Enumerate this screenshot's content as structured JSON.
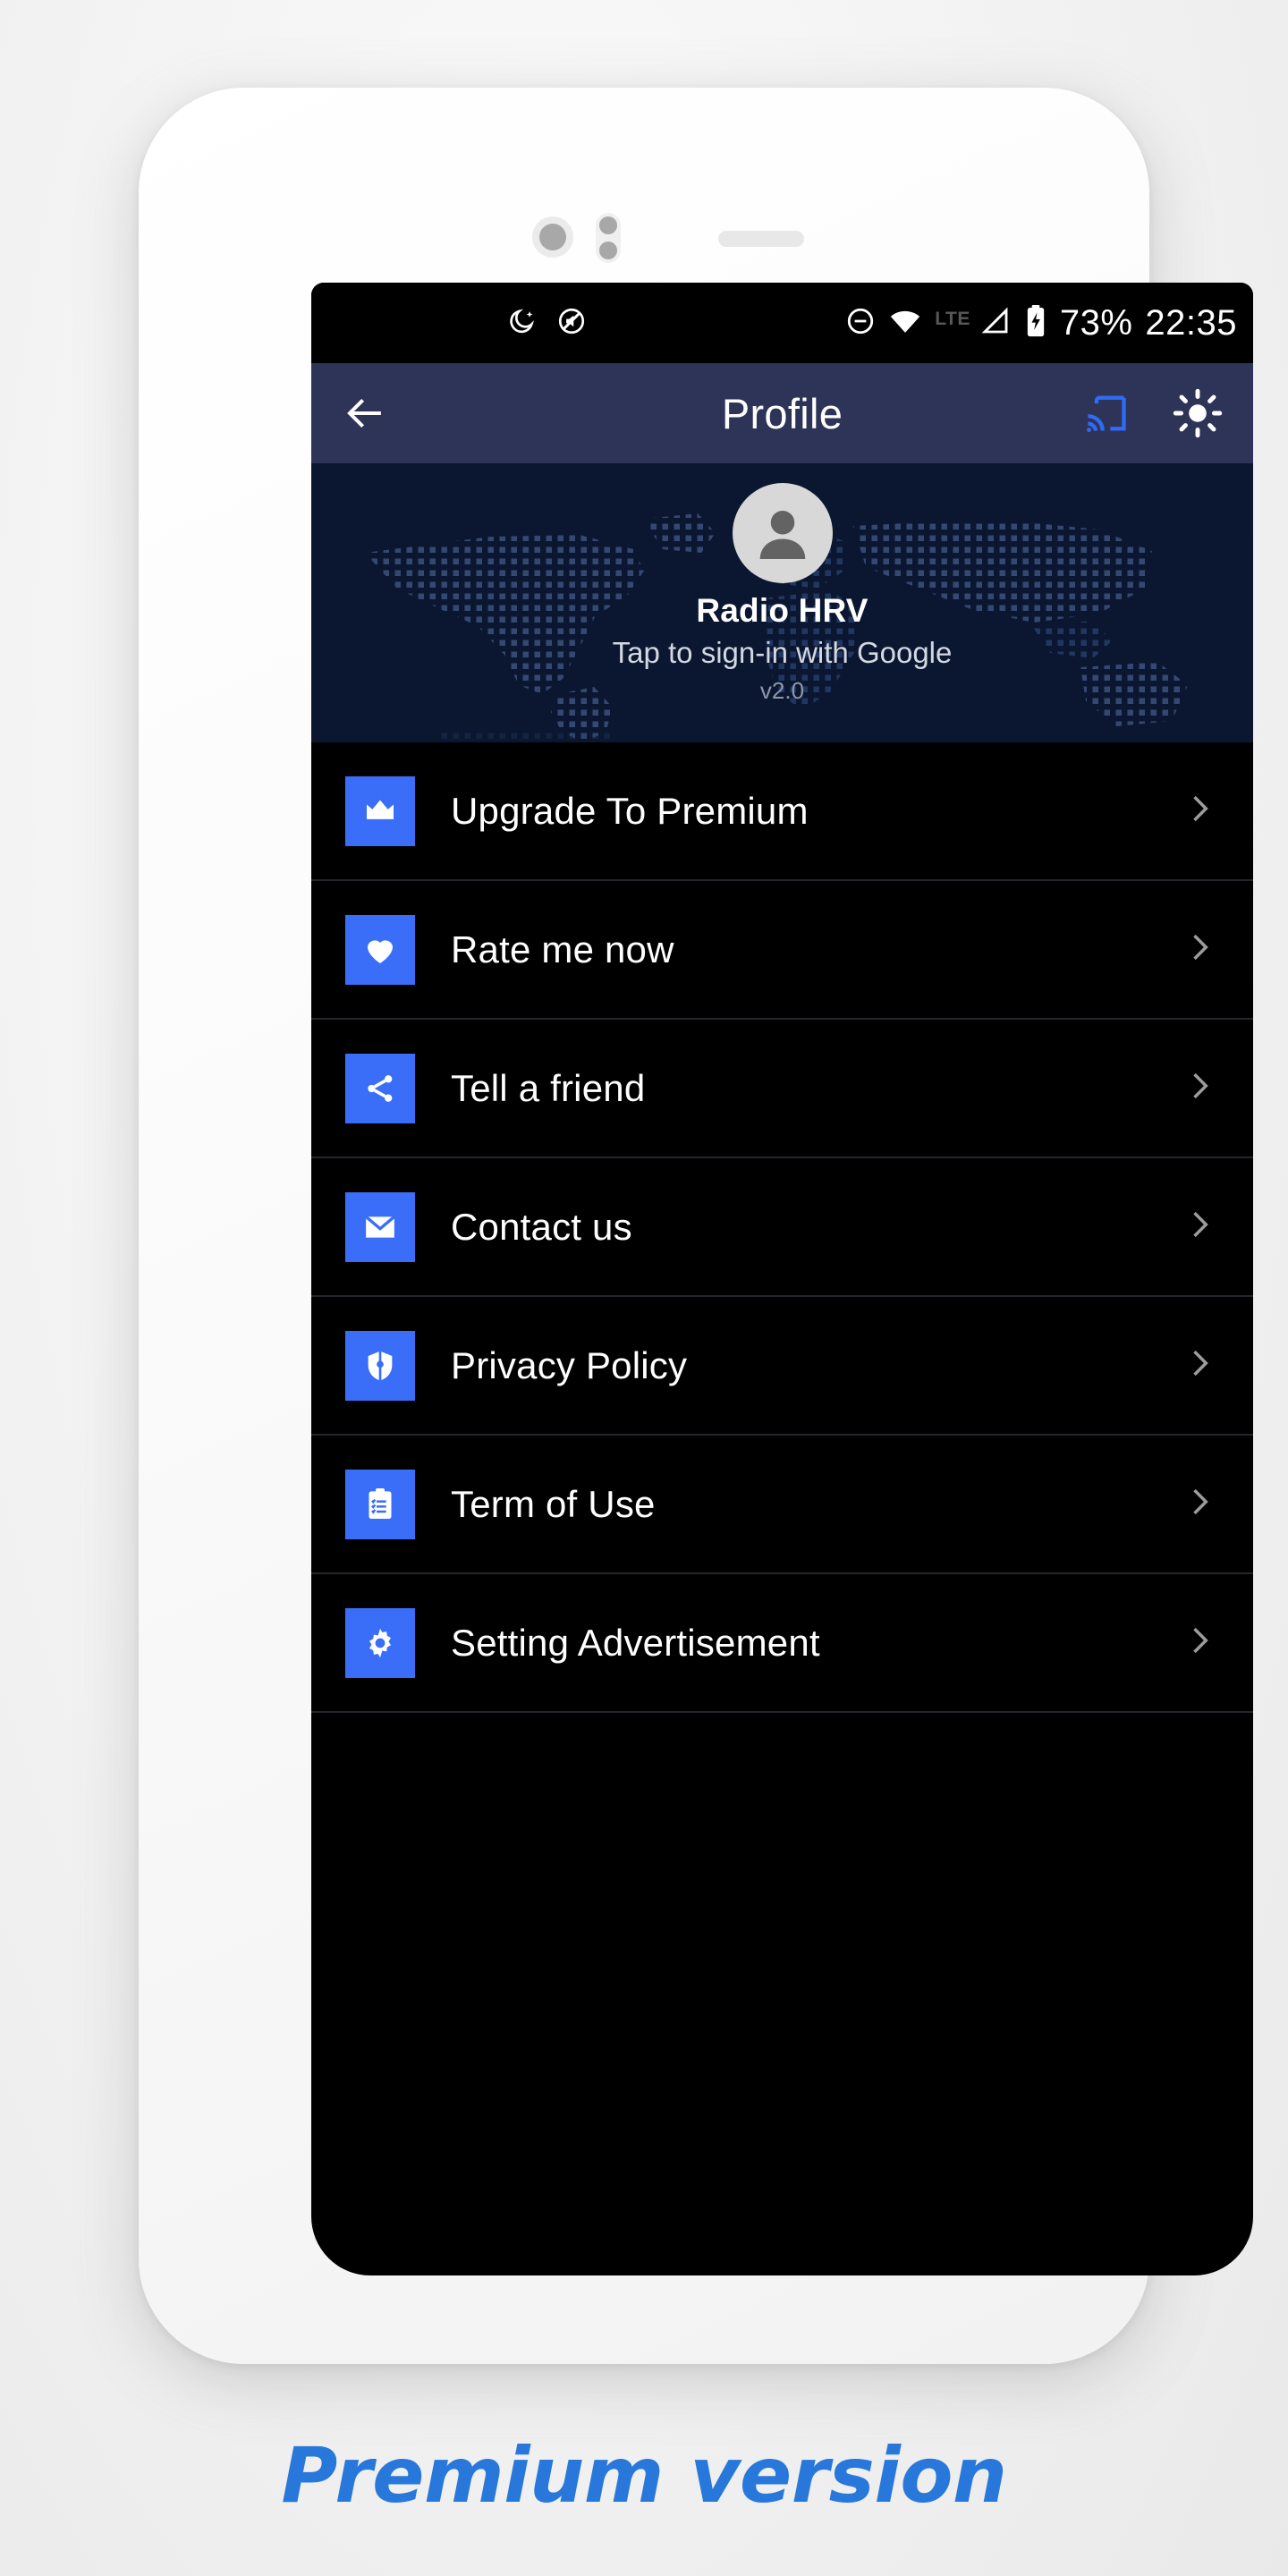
{
  "theme": {
    "accent_blue": "#3b6ef8",
    "appbar_bg": "#2e3457",
    "header_bg": "#0b1730",
    "list_bg": "#000000",
    "caption_blue": "#2878dc",
    "page_bg": "#f4f4f4"
  },
  "status_bar": {
    "left_icons": [
      "do-not-disturb-moon-icon",
      "no-sound-slash-icon"
    ],
    "right_icons": [
      "mute-minus-circle-icon",
      "wifi-icon",
      "cell-signal-icon",
      "battery-charging-icon"
    ],
    "network_label": "LTE",
    "battery_percent": "73%",
    "clock": "22:35"
  },
  "app_bar": {
    "back_icon": "arrow-left-icon",
    "title": "Profile",
    "cast_icon": "cast-icon",
    "brightness_icon": "brightness-sun-icon"
  },
  "profile": {
    "avatar_icon": "person-avatar-icon",
    "background_icon": "dotted-world-map",
    "name": "Radio HRV",
    "signin_prompt": "Tap to sign-in with Google",
    "version": "v2.0"
  },
  "menu": {
    "items": [
      {
        "label": "Upgrade To Premium",
        "icon": "crown-icon",
        "chevron": "chevron-right-icon"
      },
      {
        "label": "Rate me now",
        "icon": "heart-icon",
        "chevron": "chevron-right-icon"
      },
      {
        "label": "Tell a friend",
        "icon": "share-icon",
        "chevron": "chevron-right-icon"
      },
      {
        "label": "Contact us",
        "icon": "envelope-icon",
        "chevron": "chevron-right-icon"
      },
      {
        "label": "Privacy Policy",
        "icon": "shield-icon",
        "chevron": "chevron-right-icon"
      },
      {
        "label": "Term of Use",
        "icon": "clipboard-list-icon",
        "chevron": "chevron-right-icon"
      },
      {
        "label": "Setting Advertisement",
        "icon": "gear-icon",
        "chevron": "chevron-right-icon"
      }
    ]
  },
  "caption": {
    "text": "Premium version"
  },
  "device": {
    "camera_icon": "front-camera-lens",
    "sensor_icon": "proximity-sensor-dots",
    "speaker_icon": "earpiece-speaker-grille"
  }
}
